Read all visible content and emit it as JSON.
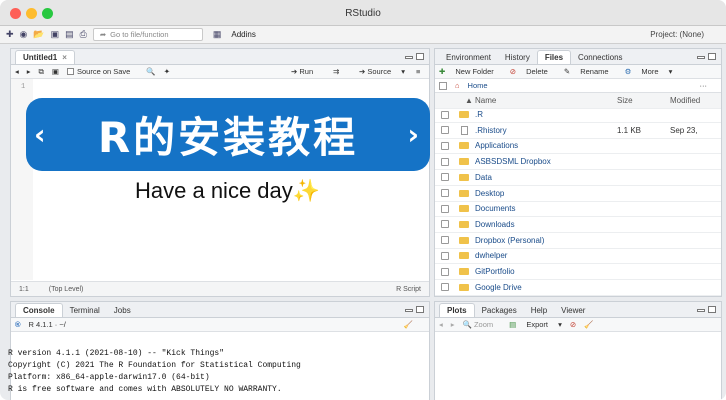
{
  "window": {
    "title": "RStudio",
    "colors": {
      "close": "#fe5f57",
      "minimize": "#febc2e",
      "maximize": "#28c840",
      "banner": "#1573c6"
    }
  },
  "toolbar": {
    "goto_placeholder": "Go to file/function",
    "addins": "Addins",
    "project": "Project: (None)"
  },
  "editor": {
    "tab": "Untitled1",
    "source_on_save": "Source on Save",
    "run": "Run",
    "source": "Source",
    "banner_title": "R的安装教程",
    "banner_prev": "‹",
    "banner_next": "›",
    "caption": "Have a nice day✨",
    "line_number": "1",
    "status_pos": "1:1",
    "status_level": "(Top Level)",
    "status_type": "R Script"
  },
  "console_pane": {
    "tabs": [
      "Console",
      "Terminal",
      "Jobs"
    ],
    "r_version_label": "R 4.1.1 · ~/",
    "lines": [
      "R version 4.1.1 (2021-08-10) -- \"Kick Things\"",
      "Copyright (C) 2021 The R Foundation for Statistical Computing",
      "Platform: x86_64-apple-darwin17.0 (64-bit)",
      "",
      "R is free software and comes with ABSOLUTELY NO WARRANTY."
    ]
  },
  "files_pane": {
    "tabs": [
      "Environment",
      "History",
      "Files",
      "Connections"
    ],
    "actions": [
      "New Folder",
      "Delete",
      "Rename",
      "More"
    ],
    "breadcrumb": "Home",
    "columns": [
      "Name",
      "Size",
      "Modified"
    ],
    "rows": [
      {
        "name": ".R",
        "size": "",
        "modified": ""
      },
      {
        "name": ".Rhistory",
        "size": "1.1 KB",
        "modified": "Sep 23,"
      },
      {
        "name": "Applications",
        "size": "",
        "modified": ""
      },
      {
        "name": "ASBSDSML Dropbox",
        "size": "",
        "modified": ""
      },
      {
        "name": "Data",
        "size": "",
        "modified": ""
      },
      {
        "name": "Desktop",
        "size": "",
        "modified": ""
      },
      {
        "name": "Documents",
        "size": "",
        "modified": ""
      },
      {
        "name": "Downloads",
        "size": "",
        "modified": ""
      },
      {
        "name": "Dropbox (Personal)",
        "size": "",
        "modified": ""
      },
      {
        "name": "dwhelper",
        "size": "",
        "modified": ""
      },
      {
        "name": "GitPortfolio",
        "size": "",
        "modified": ""
      },
      {
        "name": "Google Drive",
        "size": "",
        "modified": ""
      }
    ]
  },
  "plots_pane": {
    "tabs": [
      "Plots",
      "Packages",
      "Help",
      "Viewer"
    ],
    "zoom": "Zoom",
    "export": "Export"
  }
}
